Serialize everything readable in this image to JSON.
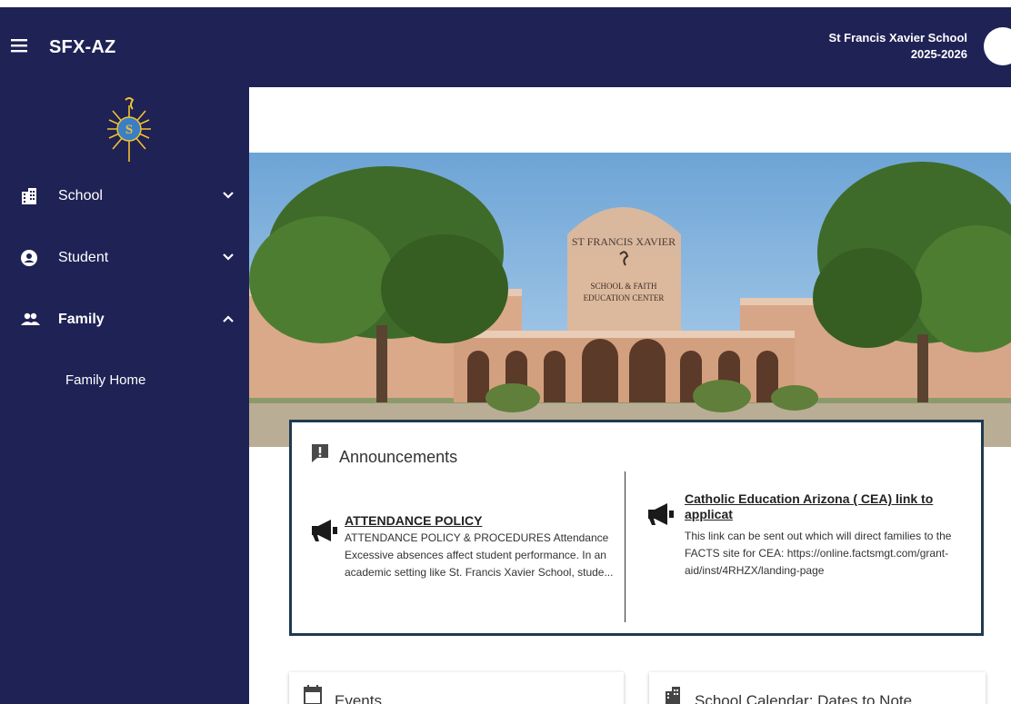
{
  "header": {
    "app_title": "SFX-AZ",
    "school_name": "St Francis Xavier School",
    "school_year": "2025-2026"
  },
  "sidebar": {
    "items": [
      {
        "label": "School",
        "icon": "building-icon",
        "expanded": false
      },
      {
        "label": "Student",
        "icon": "person-circle-icon",
        "expanded": false
      },
      {
        "label": "Family",
        "icon": "people-icon",
        "expanded": true
      }
    ],
    "subitems": [
      {
        "label": "Family Home"
      }
    ]
  },
  "announcements": {
    "title": "Announcements",
    "items": [
      {
        "title": "ATTENDANCE POLICY",
        "body": "ATTENDANCE POLICY & PROCEDURES Attendance Excessive absences affect student performance. In an academic setting like St. Francis Xavier School, stude..."
      },
      {
        "title": "Catholic Education Arizona ( CEA) link to applicat",
        "body": "This link can be sent out which will direct families to the FACTS site for CEA: https://online.factsmgt.com/grant-aid/inst/4RHZX/landing-page"
      }
    ]
  },
  "events": {
    "title": "Events"
  },
  "calendar": {
    "title": "School Calendar: Dates to Note"
  },
  "hero": {
    "sign_arch": "ST FRANCIS XAVIER",
    "sign_line1": "SCHOOL & FAITH",
    "sign_line2": "EDUCATION CENTER"
  },
  "colors": {
    "primary": "#1f2255",
    "card_border": "#1e3a4f"
  }
}
